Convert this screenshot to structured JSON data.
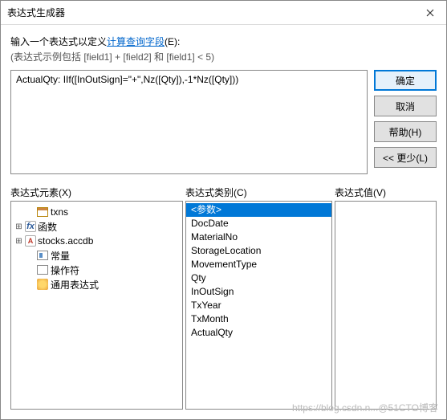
{
  "titlebar": {
    "title": "表达式生成器"
  },
  "prompt": {
    "prefix": "输入一个表达式以定义",
    "link": "计算查询字段",
    "suffix": "(E):"
  },
  "example": "(表达式示例包括 [field1] + [field2] 和 [field1] < 5)",
  "expression": "ActualQty: IIf([InOutSign]=\"+\",Nz([Qty]),-1*Nz([Qty]))",
  "buttons": {
    "ok": "确定",
    "cancel": "取消",
    "help": "帮助(H)",
    "less": "<< 更少(L)"
  },
  "headers": {
    "elements": "表达式元素(X)",
    "categories": "表达式类别(C)",
    "values": "表达式值(V)"
  },
  "tree": [
    {
      "icon": "table",
      "label": "txns",
      "expander": "",
      "indent": 14
    },
    {
      "icon": "fx",
      "label": "函数",
      "expander": "+",
      "indent": 0
    },
    {
      "icon": "db",
      "label": "stocks.accdb",
      "expander": "+",
      "indent": 0
    },
    {
      "icon": "const",
      "label": "常量",
      "expander": "",
      "indent": 14
    },
    {
      "icon": "op",
      "label": "操作符",
      "expander": "",
      "indent": 14
    },
    {
      "icon": "common",
      "label": "通用表达式",
      "expander": "",
      "indent": 14
    }
  ],
  "categories": [
    {
      "label": "<参数>",
      "selected": true
    },
    {
      "label": "DocDate"
    },
    {
      "label": "MaterialNo"
    },
    {
      "label": "StorageLocation"
    },
    {
      "label": "MovementType"
    },
    {
      "label": "Qty"
    },
    {
      "label": "InOutSign"
    },
    {
      "label": "TxYear"
    },
    {
      "label": "TxMonth"
    },
    {
      "label": "ActualQty"
    }
  ],
  "watermark": "https://blog.csdn.n...@51CTO博客"
}
